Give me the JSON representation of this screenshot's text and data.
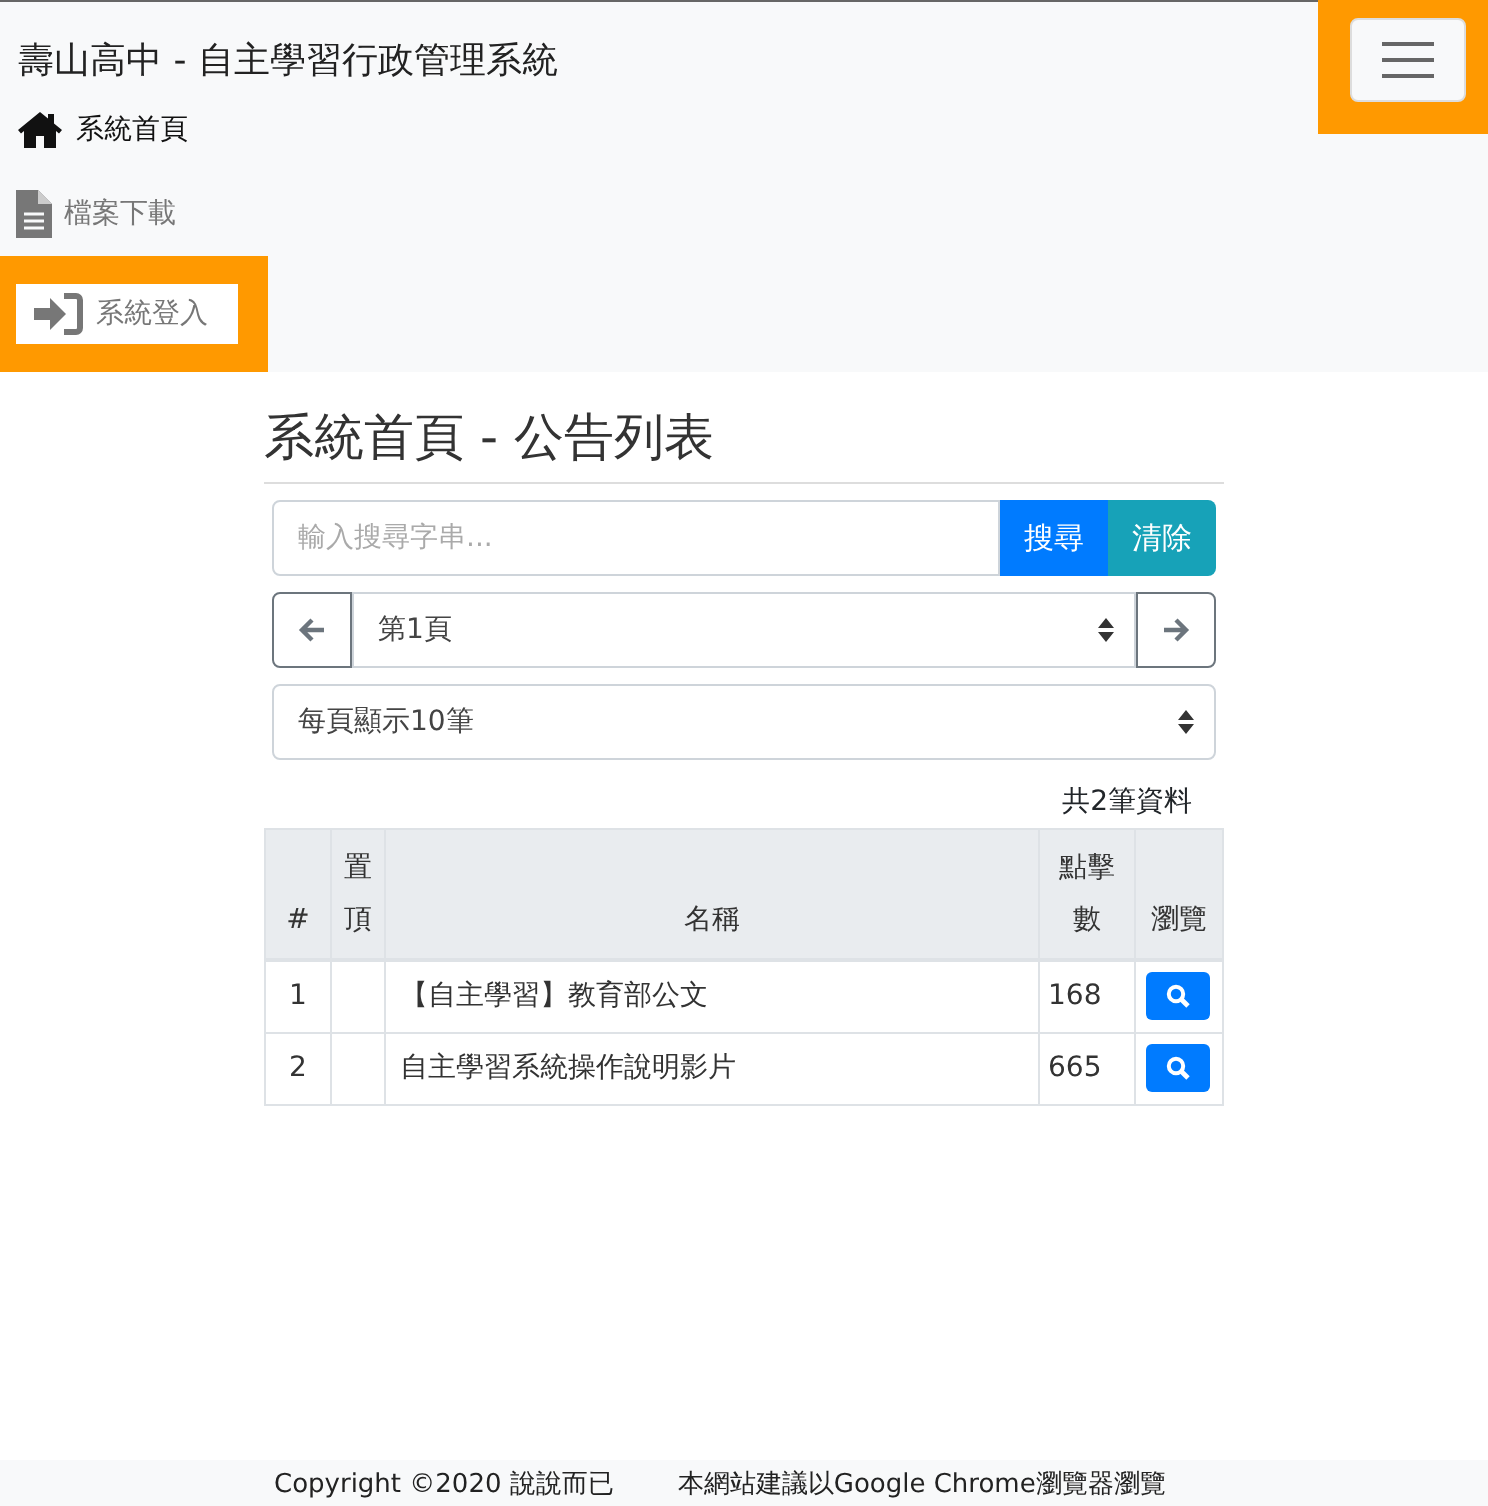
{
  "navbar": {
    "brand": "壽山高中 - 自主學習行政管理系統",
    "menu_button": {
      "highlighted": true
    },
    "items": [
      {
        "label": "系統首頁",
        "kind": "home",
        "selected": true,
        "highlighted": false
      },
      {
        "label": "檔案下載",
        "kind": "download",
        "selected": false,
        "highlighted": false
      },
      {
        "label": "系統登入",
        "kind": "login",
        "selected": false,
        "highlighted": true
      }
    ]
  },
  "heading": "系統首頁 - 公告列表",
  "search": {
    "placeholder": "輸入搜尋字串...",
    "buttons": [
      {
        "label": "搜尋",
        "kind": "primary"
      },
      {
        "label": "清除",
        "kind": "info"
      }
    ]
  },
  "pager": {
    "page": "第1頁"
  },
  "per_page": "每頁顯示10筆",
  "count": "共2筆資料",
  "table": {
    "columns": [
      "#",
      "置頂",
      "名稱",
      "點擊數",
      "瀏覽"
    ],
    "rows": [
      {
        "no": "1",
        "name": "【自主學習】教育部公文",
        "clicks": "168"
      },
      {
        "no": "2",
        "name": "自主學習系統操作說明影片",
        "clicks": "665"
      }
    ]
  },
  "footer": {
    "copyright": "Copyright ©2020 說說而已",
    "note": "本網站建議以Google Chrome瀏覽器瀏覽"
  }
}
